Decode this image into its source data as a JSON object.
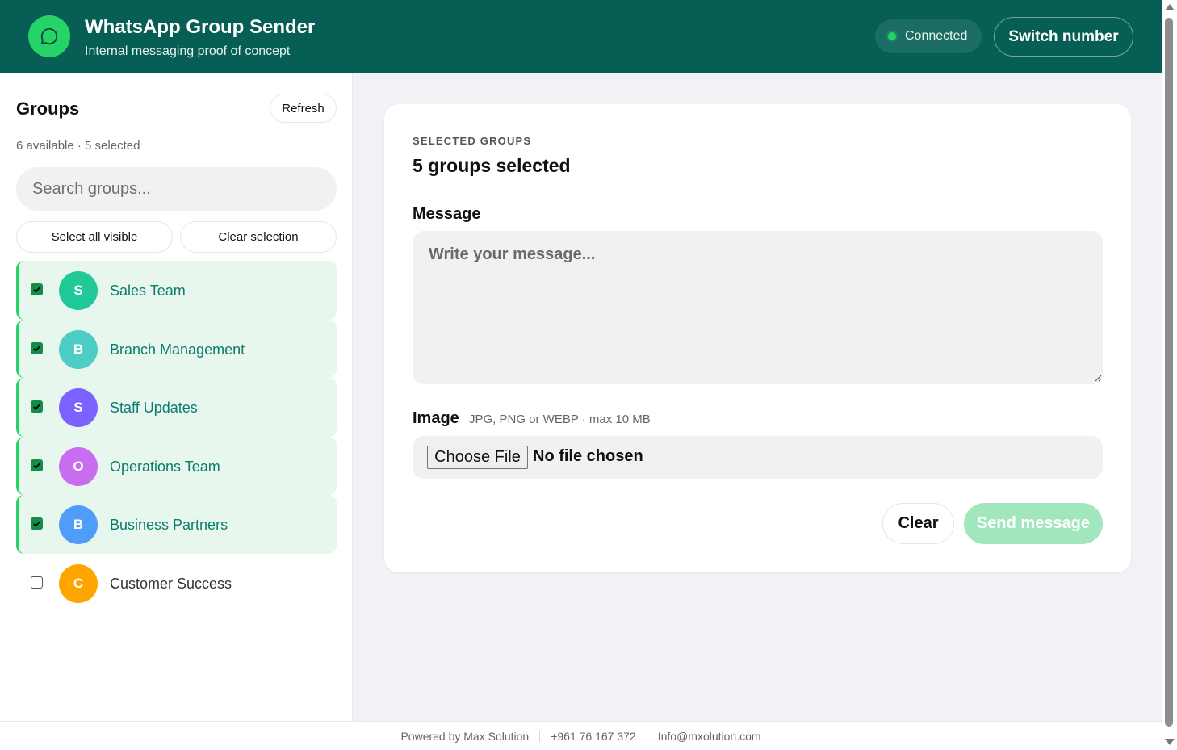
{
  "header": {
    "title": "WhatsApp Group Sender",
    "subtitle": "Internal messaging proof of concept",
    "status": "Connected",
    "switch_label": "Switch number",
    "logo_icon": "chat-bubble-icon",
    "brand_color": "#075e54",
    "accent_color": "#25d366"
  },
  "sidebar": {
    "title": "Groups",
    "refresh_label": "Refresh",
    "count_text": "6 available · 5 selected",
    "search_placeholder": "Search groups...",
    "select_all_label": "Select all visible",
    "clear_selection_label": "Clear selection",
    "groups": [
      {
        "initial": "S",
        "name": "Sales Team",
        "selected": true,
        "color": "#20c997"
      },
      {
        "initial": "B",
        "name": "Branch Management",
        "selected": true,
        "color": "#4ecdc4"
      },
      {
        "initial": "S",
        "name": "Staff Updates",
        "selected": true,
        "color": "#7b61ff"
      },
      {
        "initial": "O",
        "name": "Operations Team",
        "selected": true,
        "color": "#c86df0"
      },
      {
        "initial": "B",
        "name": "Business Partners",
        "selected": true,
        "color": "#4f9cf9"
      },
      {
        "initial": "C",
        "name": "Customer Success",
        "selected": false,
        "color": "#ffa500"
      }
    ]
  },
  "main": {
    "selected_label": "SELECTED GROUPS",
    "selected_count": "5 groups selected",
    "message_label": "Message",
    "message_placeholder": "Write your message...",
    "image_label": "Image",
    "image_hint": "JPG, PNG or WEBP · max 10 MB",
    "choose_file_label": "Choose File",
    "file_status": "No file chosen",
    "clear_label": "Clear",
    "send_label": "Send message"
  },
  "footer": {
    "powered": "Powered by Max Solution",
    "phone": "+961 76 167 372",
    "email": "Info@mxolution.com"
  }
}
